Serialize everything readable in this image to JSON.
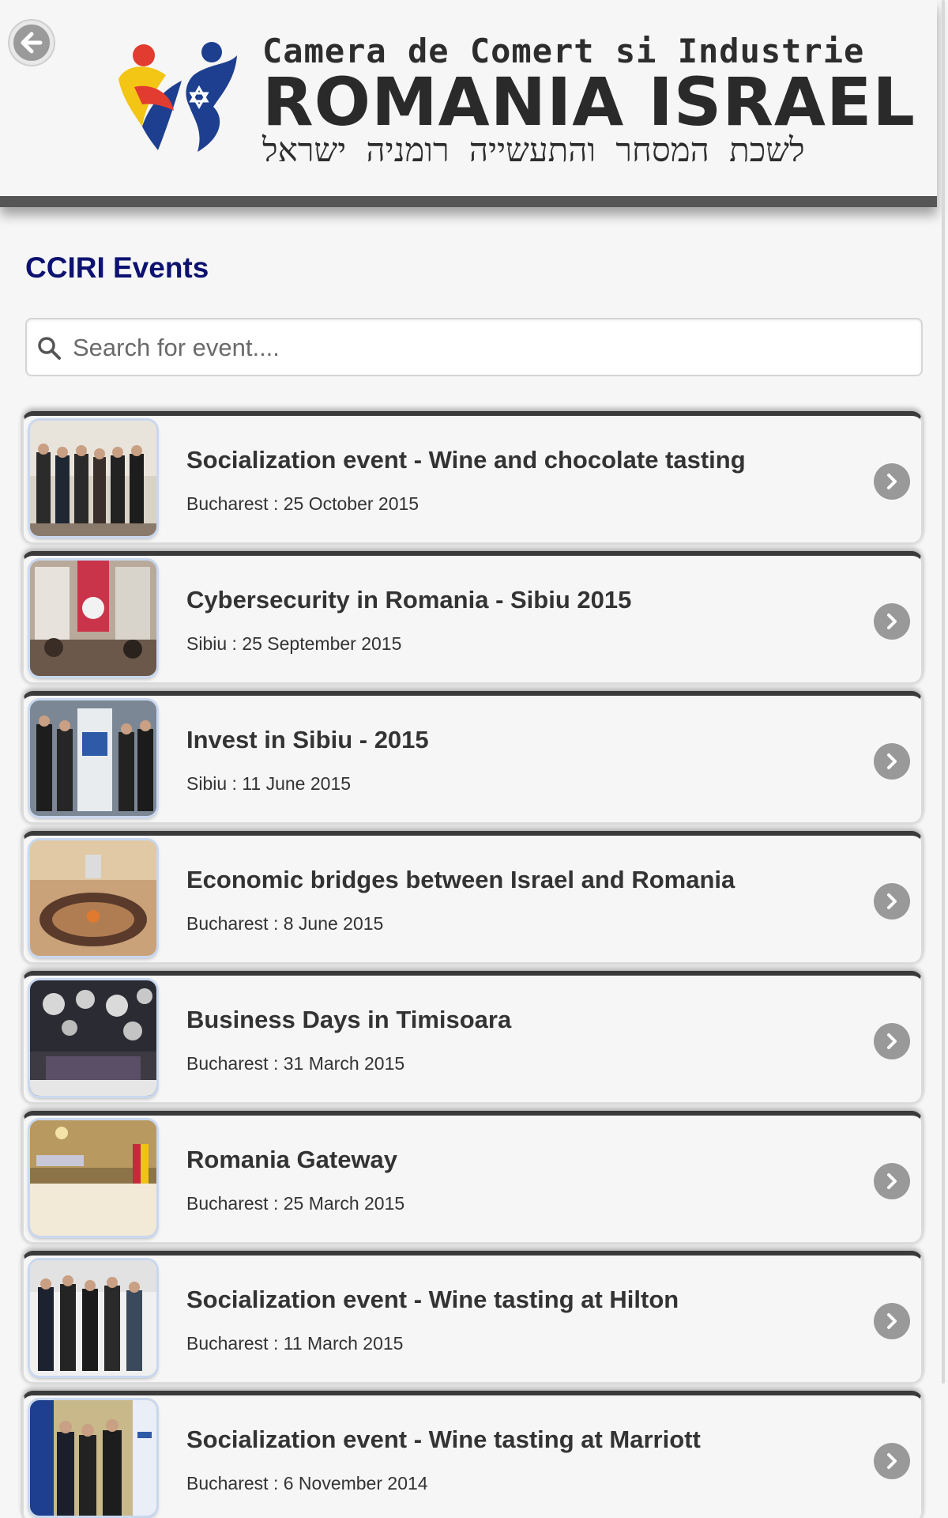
{
  "header": {
    "logo_line1": "Camera de Comert si Industrie",
    "logo_line2": "ROMANIA ISRAEL",
    "logo_line3": "לשכת המסחר והתעשייה רומניה ישראל"
  },
  "page": {
    "title": "CCIRI Events"
  },
  "search": {
    "placeholder": "Search for event....",
    "value": ""
  },
  "events": [
    {
      "title": "Socialization event - Wine and chocolate tasting",
      "location": "Bucharest",
      "date": "25 October 2015"
    },
    {
      "title": "Cybersecurity in Romania - Sibiu 2015",
      "location": "Sibiu",
      "date": "25 September 2015"
    },
    {
      "title": "Invest in Sibiu - 2015",
      "location": "Sibiu",
      "date": "11 June 2015"
    },
    {
      "title": "Economic bridges between Israel and Romania",
      "location": "Bucharest",
      "date": "8 June 2015"
    },
    {
      "title": "Business Days in Timisoara",
      "location": "Bucharest",
      "date": "31 March 2015"
    },
    {
      "title": "Romania Gateway",
      "location": "Bucharest",
      "date": "25 March 2015"
    },
    {
      "title": "Socialization event - Wine tasting at Hilton",
      "location": "Bucharest",
      "date": "11 March 2015"
    },
    {
      "title": "Socialization event - Wine tasting at Marriott",
      "location": "Bucharest",
      "date": "6 November 2014"
    }
  ],
  "meta_separator": " : ",
  "icons": {
    "back": "back-arrow-icon",
    "search": "search-icon",
    "item_arrow": "chevron-right-icon"
  },
  "colors": {
    "title": "#0d1270",
    "arrow_bg": "#999999",
    "header_bar": "#555555"
  }
}
